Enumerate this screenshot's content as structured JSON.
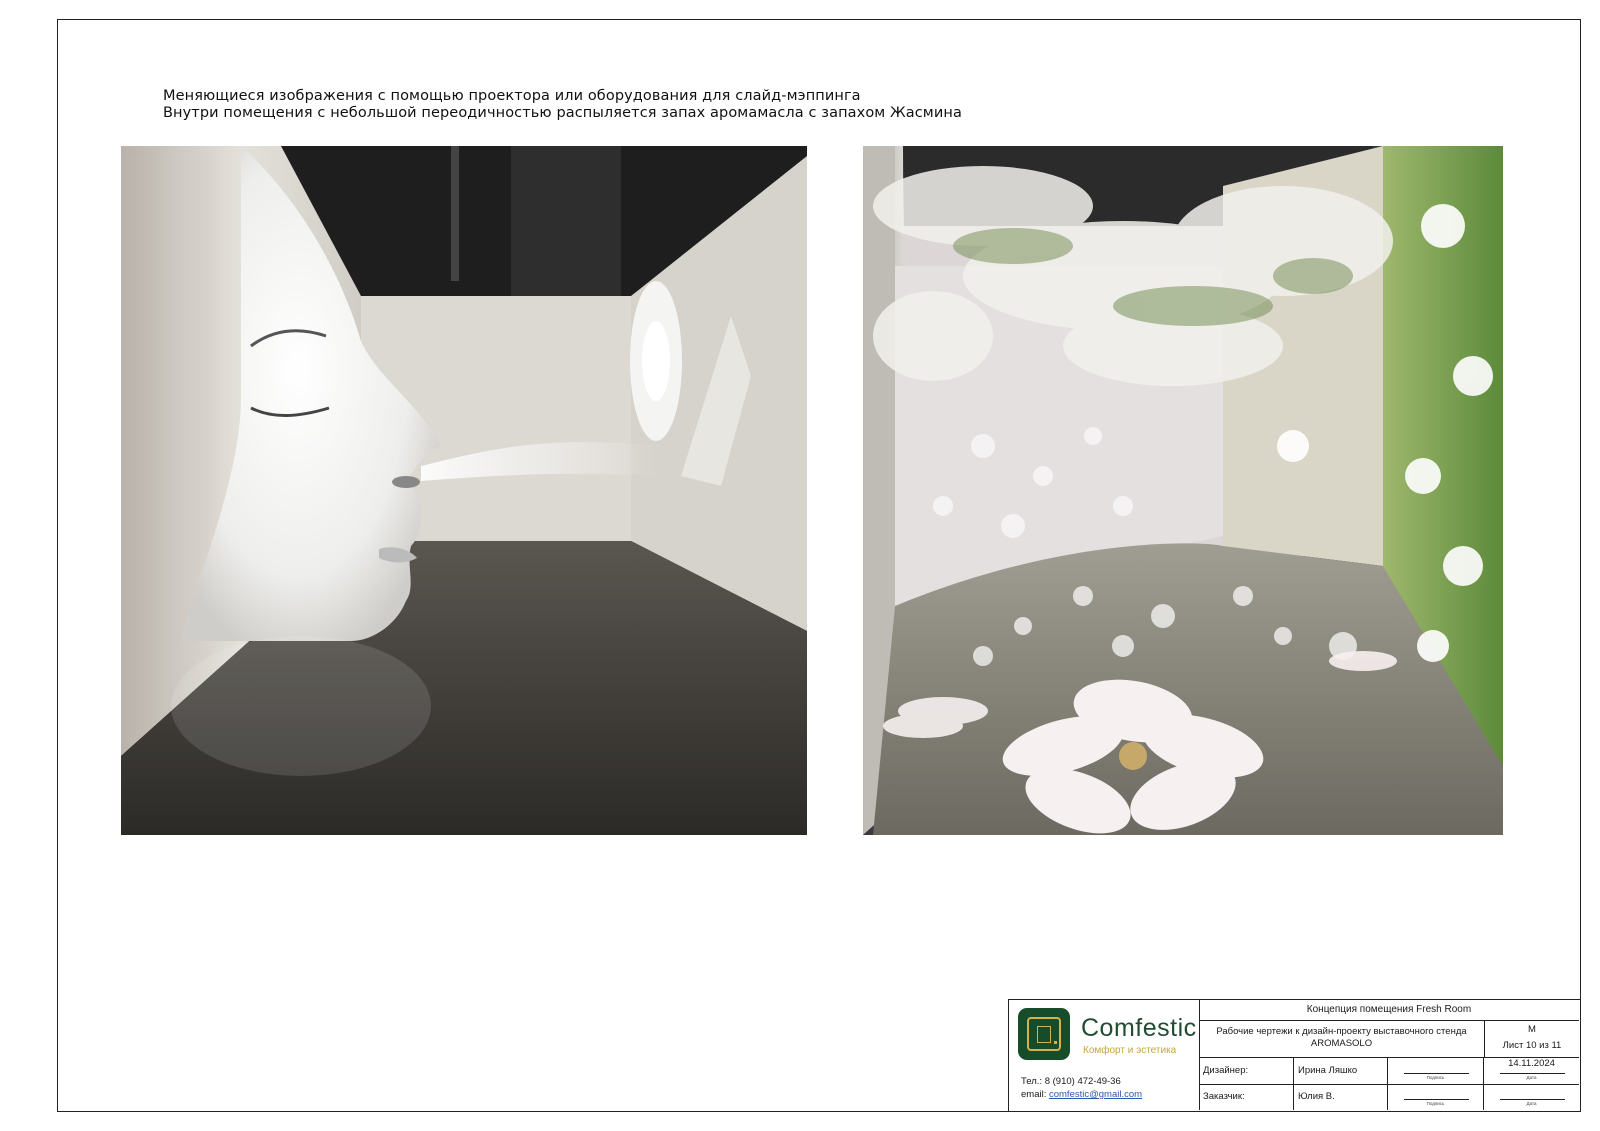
{
  "caption": {
    "line1": "Меняющиеся изображения с помощью проектора или оборудования для слайд-мэппинга",
    "line2": "Внутри помещения с небольшой переодичностью распыляется запах аромамасла с запахом Жасмина"
  },
  "title_block": {
    "brand_name": "Comfestic",
    "brand_tagline": "Комфорт и эстетика",
    "phone": "Тел.: 8 (910) 472-49-36",
    "email_label": "email:",
    "email": "comfestic@gmail.com",
    "title": "Концепция помещения Fresh Room",
    "description": "Рабочие чертежи к дизайн-проекту выставочного стенда AROMASOLO",
    "scale_label": "М",
    "sheet": "Лист 10 из 11",
    "designer_label": "Дизайнер:",
    "designer_name": "Ирина Ляшко",
    "customer_label": "Заказчик:",
    "customer_name": "Юлия В.",
    "date": "14.11.2024",
    "signature_caption": "Подпись",
    "date_caption": "Дата"
  }
}
